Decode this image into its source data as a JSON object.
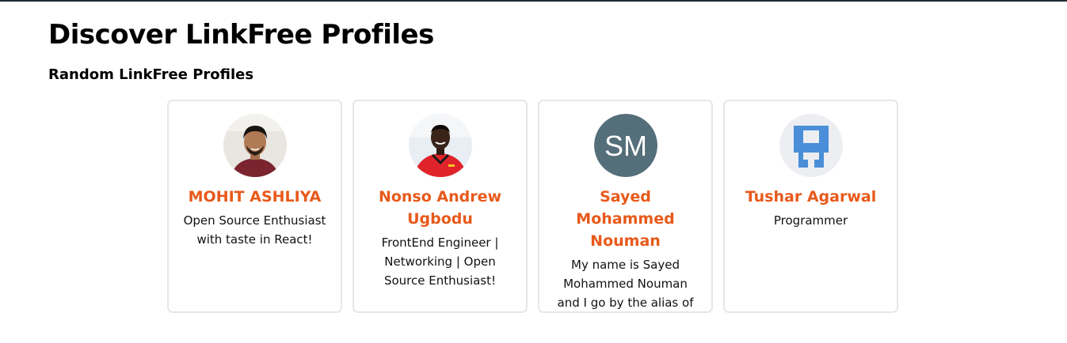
{
  "page": {
    "title": "Discover LinkFree Profiles",
    "subtitle": "Random LinkFree Profiles"
  },
  "profiles": [
    {
      "name": "MOHIT ASHLIYA",
      "bio": "Open Source Enthusiast with taste in React!",
      "avatar_type": "photo",
      "avatar_colors": {
        "bg": "#e9e6e1",
        "shirt": "#7b2430",
        "skin": "#b07a55",
        "hair": "#1a1410"
      }
    },
    {
      "name": "Nonso Andrew Ugbodu",
      "bio": "FrontEnd Engineer | Networking | Open Source Enthusiast!",
      "avatar_type": "photo",
      "avatar_colors": {
        "bg": "#e8eef3",
        "shirt": "#e0232b",
        "skin": "#3a2419",
        "hair": "#0f0a08"
      }
    },
    {
      "name": "Sayed Mohammed Nouman",
      "bio": "My name is Sayed Mohammed Nouman and I go by the alias of Skyhero. I am in my",
      "avatar_type": "initials",
      "avatar_initials": "SM",
      "avatar_colors": {
        "bg": "#546e7a",
        "text": "#ffffff"
      }
    },
    {
      "name": "Tushar Agarwal",
      "bio": "Programmer",
      "avatar_type": "logo",
      "avatar_colors": {
        "bg": "#eceef2",
        "mark": "#4a8ed8"
      }
    }
  ],
  "colors": {
    "accent": "#e8591a",
    "card_border": "#e5e7eb"
  }
}
